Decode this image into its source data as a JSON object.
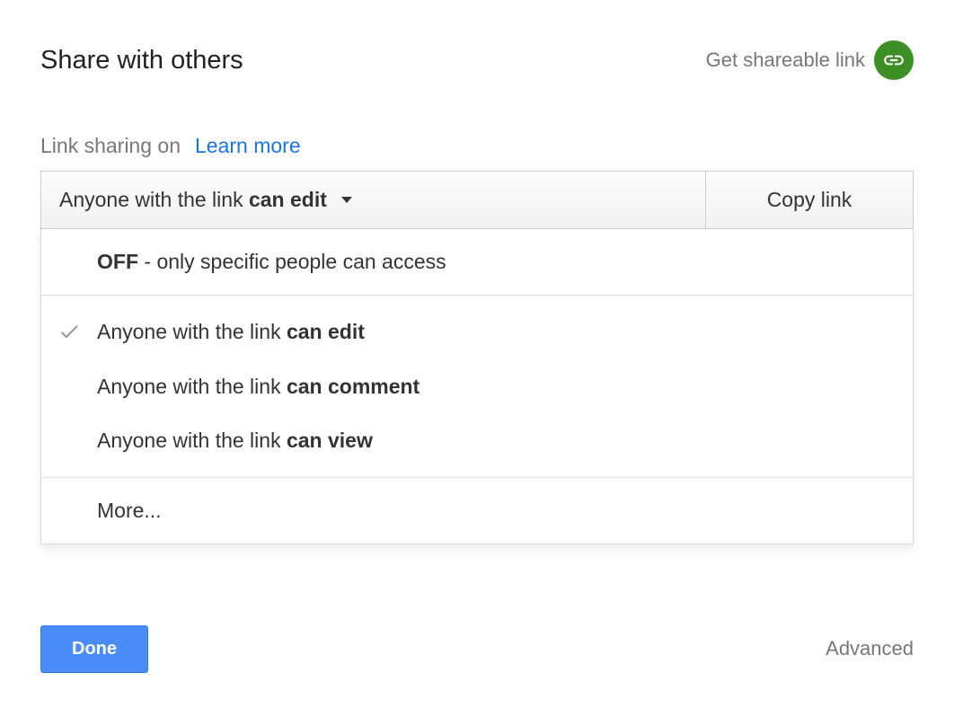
{
  "header": {
    "title": "Share with others",
    "shareable_link_label": "Get shareable link"
  },
  "status": {
    "text": "Link sharing on",
    "learn_more": "Learn more"
  },
  "dropdown": {
    "selected_prefix": "Anyone with the link ",
    "selected_bold": "can edit"
  },
  "copy_link_label": "Copy link",
  "menu": {
    "off": {
      "bold": "OFF",
      "rest": " - only specific people can access"
    },
    "options": [
      {
        "prefix": "Anyone with the link ",
        "bold": "can edit",
        "selected": true
      },
      {
        "prefix": "Anyone with the link ",
        "bold": "can comment",
        "selected": false
      },
      {
        "prefix": "Anyone with the link ",
        "bold": "can view",
        "selected": false
      }
    ],
    "more": "More..."
  },
  "footer": {
    "done": "Done",
    "advanced": "Advanced"
  }
}
